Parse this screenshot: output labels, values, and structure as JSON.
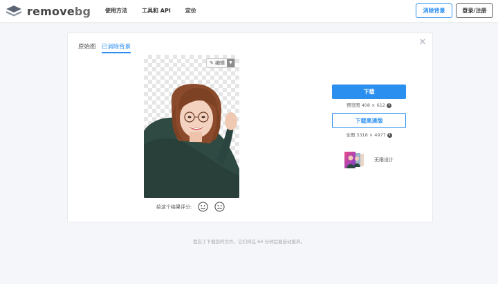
{
  "header": {
    "logo_text_main": "remove",
    "logo_text_accent": "bg",
    "nav": [
      "使用方法",
      "工具和 API",
      "定价"
    ],
    "upload_label": "消除背景",
    "login_label": "登录/注册"
  },
  "card": {
    "tabs": [
      "原始图",
      "已消除背景"
    ],
    "active_tab": 1,
    "edit_label": "编辑",
    "rating_label": "给这个结果评分:",
    "download_label": "下载",
    "preview_meta": "预览图 408 × 612",
    "download_hd_label": "下载高清版",
    "full_meta": "全图 3318 × 4977",
    "design_label": "无限设计"
  },
  "footer_note": "我忘了下载您的文件。它们将在 60 分钟后被自动废弃。",
  "colors": {
    "accent": "#2b8ff0",
    "page_bg": "#f4f6f9"
  },
  "icons": [
    "logo-stack-icon",
    "close-icon",
    "pencil-icon",
    "caret-down-icon",
    "smile-icon",
    "frown-icon",
    "info-icon"
  ]
}
